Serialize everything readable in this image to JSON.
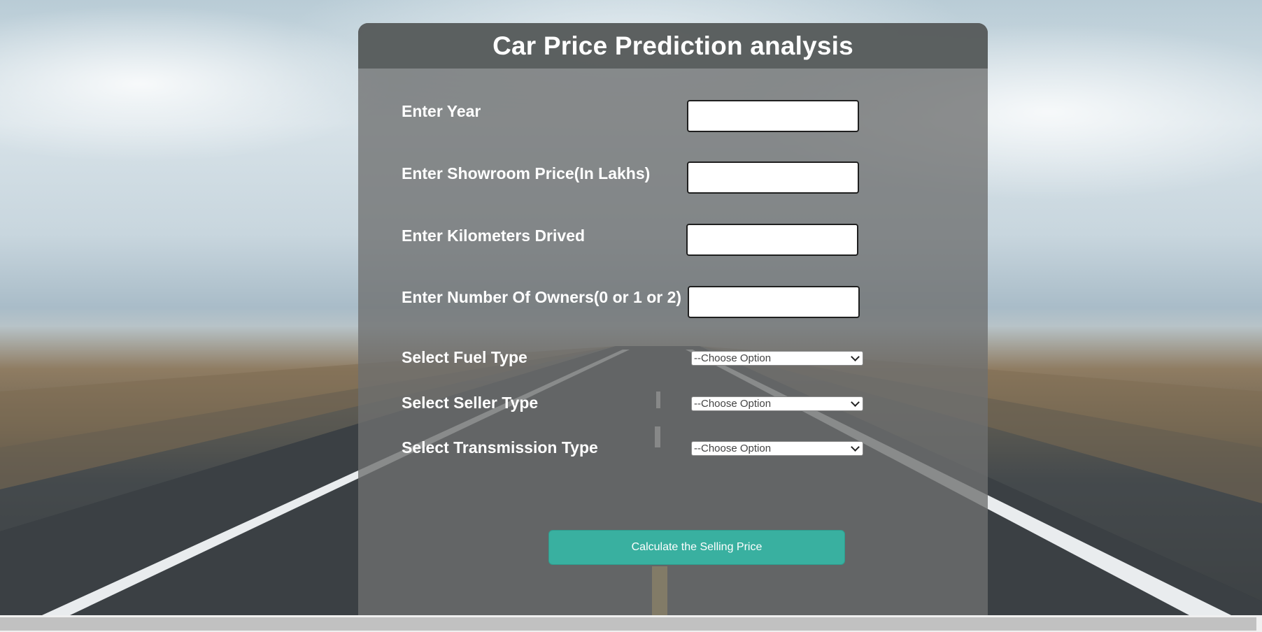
{
  "form": {
    "title": "Car Price Prediction analysis",
    "fields": [
      {
        "label": "Enter Year",
        "value": ""
      },
      {
        "label": "Enter Showroom Price(In Lakhs)",
        "value": ""
      },
      {
        "label": "Enter Kilometers Drived",
        "value": ""
      },
      {
        "label": "Enter Number Of Owners(0 or 1 or 2)",
        "value": ""
      }
    ],
    "selects": [
      {
        "label": "Select Fuel Type",
        "selected": "--Choose Option"
      },
      {
        "label": "Select Seller Type",
        "selected": "--Choose Option"
      },
      {
        "label": "Select Transmission Type",
        "selected": "--Choose Option"
      }
    ],
    "submit_label": "Calculate the Selling Price"
  },
  "colors": {
    "accent": "#39b0a0",
    "header": "#585c5c",
    "text": "#ffffff"
  }
}
